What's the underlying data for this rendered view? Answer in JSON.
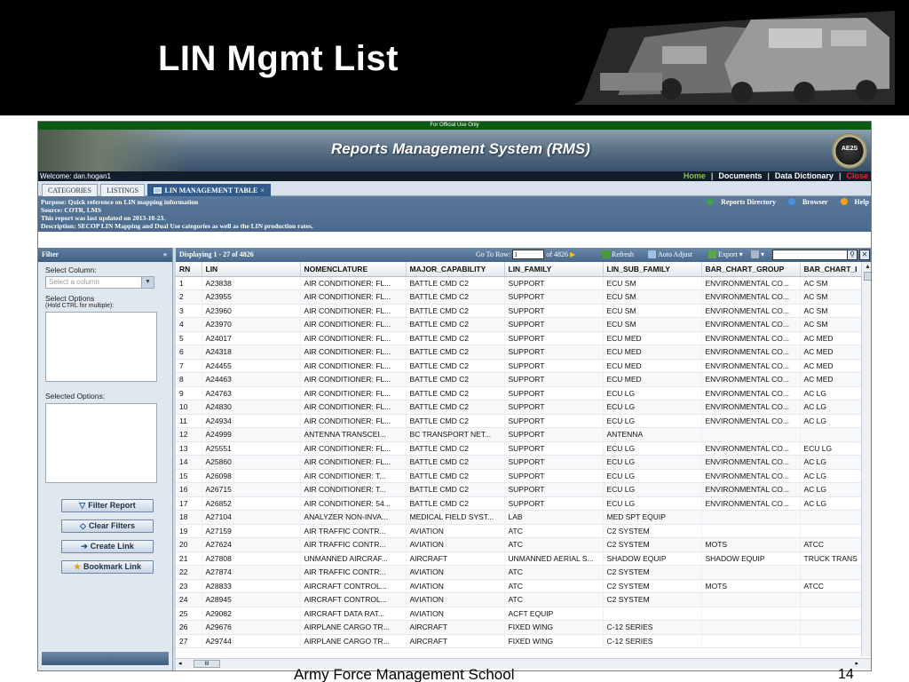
{
  "slide": {
    "title": "LIN Mgmt List",
    "footer": "Army Force Management School",
    "page_number": "14"
  },
  "app": {
    "official_banner": "For Official Use Only",
    "system_title": "Reports Management System (RMS)",
    "seal_text": "AE2S",
    "welcome": "Welcome: dan.hogan1",
    "top_links": {
      "home": "Home",
      "documents": "Documents",
      "data_dictionary": "Data Dictionary",
      "close": "Close"
    },
    "tabs": [
      {
        "label": "CATEGORIES"
      },
      {
        "label": "LISTINGS"
      },
      {
        "label": "LIN MANAGEMENT TABLE",
        "close": "×"
      }
    ],
    "purpose": {
      "line1": "Purpose: Quick reference on LIN mapping information",
      "line2": "Source: COTR, LMS",
      "line3": "This report was last updated on 2013-10-23.",
      "line4": "Description: SECOP LIN Mapping and Dual Use categories as well as the LIN production rates.",
      "line5": ".",
      "tools": {
        "reports_directory": "Reports Directory",
        "browser": "Browser",
        "help": "Help"
      }
    },
    "filter": {
      "title": "Filter",
      "select_column_label": "Select Column:",
      "select_column_placeholder": "Select a column",
      "select_options_label": "Select Options",
      "select_options_note": "(Hold CTRL for multiple):",
      "selected_options_label": "Selected Options:",
      "buttons": {
        "filter_report": "Filter Report",
        "clear_filters": "Clear Filters",
        "create_link": "Create Link",
        "bookmark_link": "Bookmark Link"
      }
    },
    "grid": {
      "displaying": "Displaying 1 - 27 of 4826",
      "goto_label": "Go To Row:",
      "goto_value": "1",
      "goto_of": "of 4826",
      "toolbar": {
        "refresh": "Refresh",
        "auto_adjust": "Auto Adjust",
        "export": "Export"
      },
      "columns": [
        "RN",
        "LIN",
        "NOMENCLATURE",
        "MAJOR_CAPABILITY",
        "LIN_FAMILY",
        "LIN_SUB_FAMILY",
        "BAR_CHART_GROUP",
        "BAR_CHART_I"
      ],
      "rows": [
        [
          "1",
          "A23838",
          "AIR CONDITIONER: FL...",
          "BATTLE CMD C2",
          "SUPPORT",
          "ECU SM",
          "ENVIRONMENTAL CO...",
          "AC SM"
        ],
        [
          "2",
          "A23955",
          "AIR CONDITIONER: FL...",
          "BATTLE CMD C2",
          "SUPPORT",
          "ECU SM",
          "ENVIRONMENTAL CO...",
          "AC SM"
        ],
        [
          "3",
          "A23960",
          "AIR CONDITIONER: FL...",
          "BATTLE CMD C2",
          "SUPPORT",
          "ECU SM",
          "ENVIRONMENTAL CO...",
          "AC SM"
        ],
        [
          "4",
          "A23970",
          "AIR CONDITIONER: FL...",
          "BATTLE CMD C2",
          "SUPPORT",
          "ECU SM",
          "ENVIRONMENTAL CO...",
          "AC SM"
        ],
        [
          "5",
          "A24017",
          "AIR CONDITIONER: FL...",
          "BATTLE CMD C2",
          "SUPPORT",
          "ECU MED",
          "ENVIRONMENTAL CO...",
          "AC MED"
        ],
        [
          "6",
          "A24318",
          "AIR CONDITIONER: FL...",
          "BATTLE CMD C2",
          "SUPPORT",
          "ECU MED",
          "ENVIRONMENTAL CO...",
          "AC MED"
        ],
        [
          "7",
          "A24455",
          "AIR CONDITIONER: FL...",
          "BATTLE CMD C2",
          "SUPPORT",
          "ECU MED",
          "ENVIRONMENTAL CO...",
          "AC MED"
        ],
        [
          "8",
          "A24463",
          "AIR CONDITIONER: FL...",
          "BATTLE CMD C2",
          "SUPPORT",
          "ECU MED",
          "ENVIRONMENTAL CO...",
          "AC MED"
        ],
        [
          "9",
          "A24763",
          "AIR CONDITIONER: FL...",
          "BATTLE CMD C2",
          "SUPPORT",
          "ECU LG",
          "ENVIRONMENTAL CO...",
          "AC LG"
        ],
        [
          "10",
          "A24830",
          "AIR CONDITIONER: FL...",
          "BATTLE CMD C2",
          "SUPPORT",
          "ECU LG",
          "ENVIRONMENTAL CO...",
          "AC LG"
        ],
        [
          "11",
          "A24934",
          "AIR CONDITIONER: FL...",
          "BATTLE CMD C2",
          "SUPPORT",
          "ECU LG",
          "ENVIRONMENTAL CO...",
          "AC LG"
        ],
        [
          "12",
          "A24999",
          "ANTENNA TRANSCEI...",
          "BC TRANSPORT NET...",
          "SUPPORT",
          "ANTENNA",
          "",
          ""
        ],
        [
          "13",
          "A25551",
          "AIR CONDITIONER: FL...",
          "BATTLE CMD C2",
          "SUPPORT",
          "ECU LG",
          "ENVIRONMENTAL CO...",
          "ECU LG"
        ],
        [
          "14",
          "A25860",
          "AIR CONDITIONER: FL...",
          "BATTLE CMD C2",
          "SUPPORT",
          "ECU LG",
          "ENVIRONMENTAL CO...",
          "AC LG"
        ],
        [
          "15",
          "A26098",
          "AIR CONDITIONER: T...",
          "BATTLE CMD C2",
          "SUPPORT",
          "ECU LG",
          "ENVIRONMENTAL CO...",
          "AC LG"
        ],
        [
          "16",
          "A26715",
          "AIR CONDITIONER: T...",
          "BATTLE CMD C2",
          "SUPPORT",
          "ECU LG",
          "ENVIRONMENTAL CO...",
          "AC LG"
        ],
        [
          "17",
          "A26852",
          "AIR CONDITIONER: 54...",
          "BATTLE CMD C2",
          "SUPPORT",
          "ECU LG",
          "ENVIRONMENTAL CO...",
          "AC LG"
        ],
        [
          "18",
          "A27104",
          "ANALYZER NON-INVA...",
          "MEDICAL FIELD SYST...",
          "LAB",
          "MED SPT EQUIP",
          "",
          ""
        ],
        [
          "19",
          "A27159",
          "AIR TRAFFIC CONTR...",
          "AVIATION",
          "ATC",
          "C2 SYSTEM",
          "",
          ""
        ],
        [
          "20",
          "A27624",
          "AIR TRAFFIC CONTR...",
          "AVIATION",
          "ATC",
          "C2 SYSTEM",
          "MOTS",
          "ATCC"
        ],
        [
          "21",
          "A27808",
          "UNMANNED AIRCRAF...",
          "AIRCRAFT",
          "UNMANNED AERIAL S...",
          "SHADOW EQUIP",
          "SHADOW EQUIP",
          "TRUCK TRANS"
        ],
        [
          "22",
          "A27874",
          "AIR TRAFFIC CONTR...",
          "AVIATION",
          "ATC",
          "C2 SYSTEM",
          "",
          ""
        ],
        [
          "23",
          "A28833",
          "AIRCRAFT CONTROL...",
          "AVIATION",
          "ATC",
          "C2 SYSTEM",
          "MOTS",
          "ATCC"
        ],
        [
          "24",
          "A28945",
          "AIRCRAFT CONTROL...",
          "AVIATION",
          "ATC",
          "C2 SYSTEM",
          "",
          ""
        ],
        [
          "25",
          "A29082",
          "AIRCRAFT DATA RAT...",
          "AVIATION",
          "ACFT EQUIP",
          "",
          "",
          ""
        ],
        [
          "26",
          "A29676",
          "AIRPLANE CARGO TR...",
          "AIRCRAFT",
          "FIXED WING",
          "C-12 SERIES",
          "",
          ""
        ],
        [
          "27",
          "A29744",
          "AIRPLANE CARGO TR...",
          "AIRCRAFT",
          "FIXED WING",
          "C-12 SERIES",
          "",
          ""
        ]
      ],
      "hscroll_thumb": "III"
    }
  }
}
